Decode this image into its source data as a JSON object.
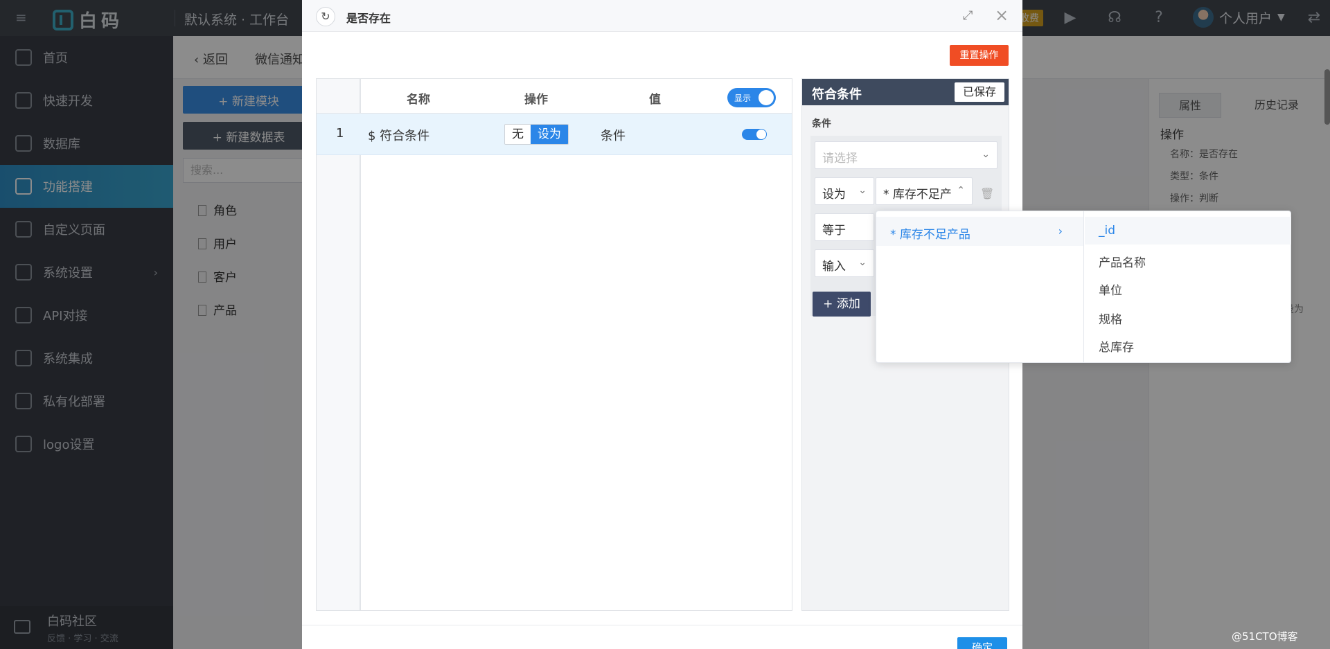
{
  "topbar": {
    "logo_text": "白码",
    "workspace": "默认系统 · 工作台",
    "badge": "收费",
    "user_name": "个人用户"
  },
  "sidebar": {
    "items": [
      {
        "label": "首页"
      },
      {
        "label": "快速开发"
      },
      {
        "label": "数据库"
      },
      {
        "label": "功能搭建"
      },
      {
        "label": "自定义页面"
      },
      {
        "label": "系统设置"
      },
      {
        "label": "API对接"
      },
      {
        "label": "系统集成"
      },
      {
        "label": "私有化部署"
      },
      {
        "label": "logo设置"
      }
    ],
    "community_title": "白码社区",
    "community_sub": "反馈 · 学习 · 交流"
  },
  "background": {
    "back_label": "返回",
    "crumb": "微信通知",
    "new_module": "+ 新建模块",
    "new_db": "+ 新建数据表",
    "search_placeholder": "搜索...",
    "tree": [
      "角色",
      "用户",
      "客户",
      "产品"
    ],
    "right_tabs": [
      "属性",
      "历史记录"
    ],
    "section": "操作",
    "props": [
      "名称：是否存在",
      "类型：条件",
      "操作：判断"
    ],
    "set_btn": "设为"
  },
  "modal": {
    "title": "是否存在",
    "reset_label": "重置操作",
    "confirm_label": "确定",
    "table": {
      "headers": {
        "name": "名称",
        "operation": "操作",
        "value": "值"
      },
      "show_toggle": "显示",
      "rows": [
        {
          "index": "1",
          "name": "$ 符合条件",
          "seg_off": "无",
          "seg_on": "设为",
          "value": "条件"
        }
      ]
    },
    "cond": {
      "title": "符合条件",
      "saved_label": "已保存",
      "label": "条件",
      "select_placeholder": "请选择",
      "row1_op": "设为",
      "row1_val": "* 库存不足产",
      "row2_op": "等于",
      "row3_op": "输入",
      "add_label": "+ 添加"
    }
  },
  "cascade": {
    "level1": "* 库存不足产品",
    "level2": [
      "_id",
      "产品名称",
      "单位",
      "规格",
      "总库存"
    ]
  },
  "watermark": "@51CTO博客"
}
